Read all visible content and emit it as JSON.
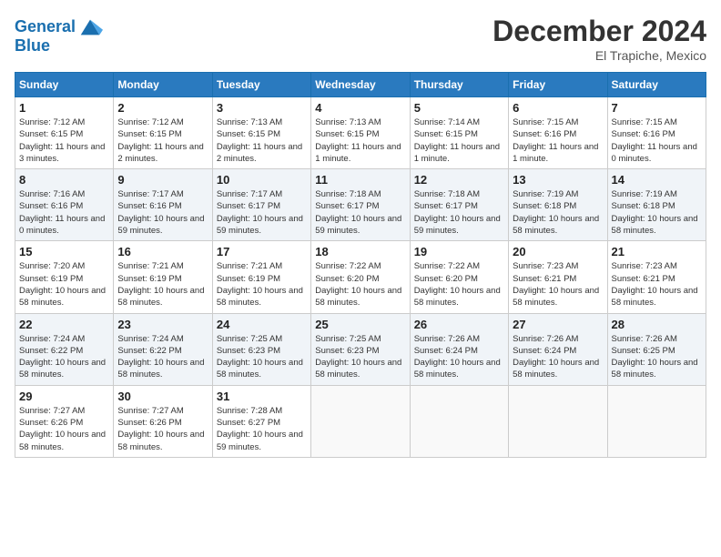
{
  "header": {
    "logo_line1": "General",
    "logo_line2": "Blue",
    "month": "December 2024",
    "location": "El Trapiche, Mexico"
  },
  "weekdays": [
    "Sunday",
    "Monday",
    "Tuesday",
    "Wednesday",
    "Thursday",
    "Friday",
    "Saturday"
  ],
  "weeks": [
    [
      {
        "day": "1",
        "sunrise": "7:12 AM",
        "sunset": "6:15 PM",
        "daylight": "11 hours and 3 minutes."
      },
      {
        "day": "2",
        "sunrise": "7:12 AM",
        "sunset": "6:15 PM",
        "daylight": "11 hours and 2 minutes."
      },
      {
        "day": "3",
        "sunrise": "7:13 AM",
        "sunset": "6:15 PM",
        "daylight": "11 hours and 2 minutes."
      },
      {
        "day": "4",
        "sunrise": "7:13 AM",
        "sunset": "6:15 PM",
        "daylight": "11 hours and 1 minute."
      },
      {
        "day": "5",
        "sunrise": "7:14 AM",
        "sunset": "6:15 PM",
        "daylight": "11 hours and 1 minute."
      },
      {
        "day": "6",
        "sunrise": "7:15 AM",
        "sunset": "6:16 PM",
        "daylight": "11 hours and 1 minute."
      },
      {
        "day": "7",
        "sunrise": "7:15 AM",
        "sunset": "6:16 PM",
        "daylight": "11 hours and 0 minutes."
      }
    ],
    [
      {
        "day": "8",
        "sunrise": "7:16 AM",
        "sunset": "6:16 PM",
        "daylight": "11 hours and 0 minutes."
      },
      {
        "day": "9",
        "sunrise": "7:17 AM",
        "sunset": "6:16 PM",
        "daylight": "10 hours and 59 minutes."
      },
      {
        "day": "10",
        "sunrise": "7:17 AM",
        "sunset": "6:17 PM",
        "daylight": "10 hours and 59 minutes."
      },
      {
        "day": "11",
        "sunrise": "7:18 AM",
        "sunset": "6:17 PM",
        "daylight": "10 hours and 59 minutes."
      },
      {
        "day": "12",
        "sunrise": "7:18 AM",
        "sunset": "6:17 PM",
        "daylight": "10 hours and 59 minutes."
      },
      {
        "day": "13",
        "sunrise": "7:19 AM",
        "sunset": "6:18 PM",
        "daylight": "10 hours and 58 minutes."
      },
      {
        "day": "14",
        "sunrise": "7:19 AM",
        "sunset": "6:18 PM",
        "daylight": "10 hours and 58 minutes."
      }
    ],
    [
      {
        "day": "15",
        "sunrise": "7:20 AM",
        "sunset": "6:19 PM",
        "daylight": "10 hours and 58 minutes."
      },
      {
        "day": "16",
        "sunrise": "7:21 AM",
        "sunset": "6:19 PM",
        "daylight": "10 hours and 58 minutes."
      },
      {
        "day": "17",
        "sunrise": "7:21 AM",
        "sunset": "6:19 PM",
        "daylight": "10 hours and 58 minutes."
      },
      {
        "day": "18",
        "sunrise": "7:22 AM",
        "sunset": "6:20 PM",
        "daylight": "10 hours and 58 minutes."
      },
      {
        "day": "19",
        "sunrise": "7:22 AM",
        "sunset": "6:20 PM",
        "daylight": "10 hours and 58 minutes."
      },
      {
        "day": "20",
        "sunrise": "7:23 AM",
        "sunset": "6:21 PM",
        "daylight": "10 hours and 58 minutes."
      },
      {
        "day": "21",
        "sunrise": "7:23 AM",
        "sunset": "6:21 PM",
        "daylight": "10 hours and 58 minutes."
      }
    ],
    [
      {
        "day": "22",
        "sunrise": "7:24 AM",
        "sunset": "6:22 PM",
        "daylight": "10 hours and 58 minutes."
      },
      {
        "day": "23",
        "sunrise": "7:24 AM",
        "sunset": "6:22 PM",
        "daylight": "10 hours and 58 minutes."
      },
      {
        "day": "24",
        "sunrise": "7:25 AM",
        "sunset": "6:23 PM",
        "daylight": "10 hours and 58 minutes."
      },
      {
        "day": "25",
        "sunrise": "7:25 AM",
        "sunset": "6:23 PM",
        "daylight": "10 hours and 58 minutes."
      },
      {
        "day": "26",
        "sunrise": "7:26 AM",
        "sunset": "6:24 PM",
        "daylight": "10 hours and 58 minutes."
      },
      {
        "day": "27",
        "sunrise": "7:26 AM",
        "sunset": "6:24 PM",
        "daylight": "10 hours and 58 minutes."
      },
      {
        "day": "28",
        "sunrise": "7:26 AM",
        "sunset": "6:25 PM",
        "daylight": "10 hours and 58 minutes."
      }
    ],
    [
      {
        "day": "29",
        "sunrise": "7:27 AM",
        "sunset": "6:26 PM",
        "daylight": "10 hours and 58 minutes."
      },
      {
        "day": "30",
        "sunrise": "7:27 AM",
        "sunset": "6:26 PM",
        "daylight": "10 hours and 58 minutes."
      },
      {
        "day": "31",
        "sunrise": "7:28 AM",
        "sunset": "6:27 PM",
        "daylight": "10 hours and 59 minutes."
      },
      null,
      null,
      null,
      null
    ]
  ],
  "labels": {
    "sunrise": "Sunrise:",
    "sunset": "Sunset:",
    "daylight": "Daylight hours"
  }
}
